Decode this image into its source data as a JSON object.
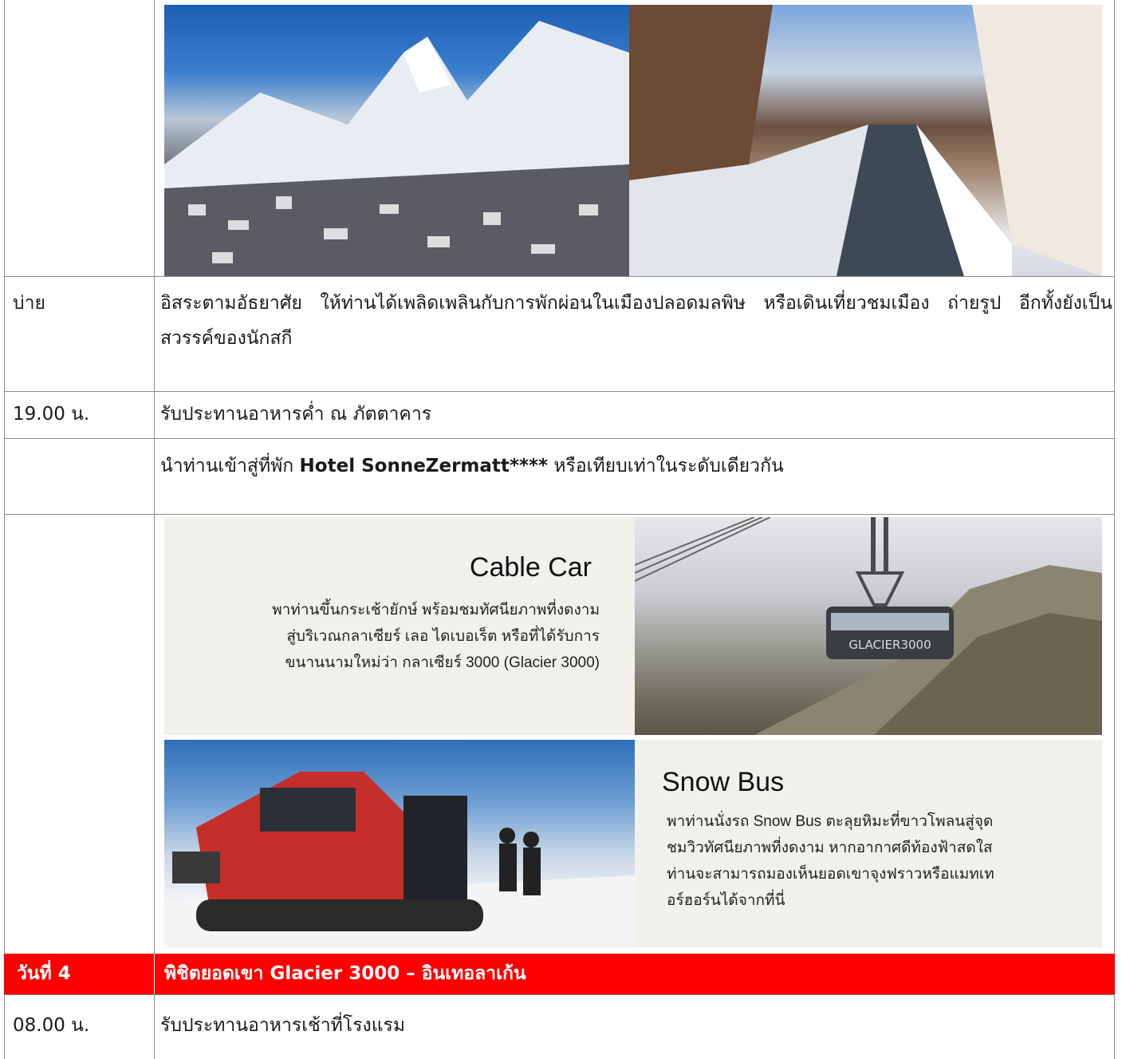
{
  "rows": [
    {
      "time": "บ่าย",
      "desc": "อิสระตามอัธยาศัย ให้ท่านได้เพลิดเพลินกับการพักผ่อนในเมืองปลอดมลพิษ หรือเดินเที่ยวชมเมือง ถ่ายรูป อีกทั้งยังเป็นสวรรค์ของนักสกี"
    },
    {
      "time": "19.00 น.",
      "desc": "รับประทานอาหารค่ำ ณ ภัตตาคาร"
    },
    {
      "time": "",
      "desc_prefix": "นำท่านเข้าสู่ที่พัก ",
      "desc_bold": "Hotel SonneZermatt****",
      "desc_suffix": " หรือเทียบเท่าในระดับเดียวกัน"
    }
  ],
  "cable_car": {
    "title": "Cable Car",
    "lines": [
      "พาท่านขึ้นกระเช้ายักษ์ พร้อมชมทัศนียภาพที่งดงาม",
      "สู่บริเวณกลาเซียร์ เลอ ไดเบอเร็ต หรือที่ได้รับการ",
      "ขนานนามใหม่ว่า กลาเซียร์ 3000 (Glacier 3000)"
    ],
    "gondola_label": "GLACIER3000"
  },
  "snow_bus": {
    "title": "Snow Bus",
    "lines": [
      "พาท่านนั่งรถ Snow Bus ตะลุยหิมะที่ขาวโพลนสู่จุด",
      "ชมวิวทัศนียภาพที่งดงาม หากอากาศดีท้องฟ้าสดใส",
      "ท่านจะสามารถมองเห็นยอดเขาจุงฟราวหรือแมทเท",
      "อร์ฮอร์นได้จากที่นี่"
    ]
  },
  "day4": {
    "day": "วันที่ 4",
    "title": "พิชิตยอดเขา Glacier 3000 – อินเทอลาเก้น"
  },
  "last_row": {
    "time": "08.00 น.",
    "desc": "รับประทานอาหารเช้าที่โรงแรม"
  },
  "colors": {
    "header_red": "#ff0000",
    "border": "#8c8c8c",
    "panel_bg": "#f1f0eb"
  }
}
